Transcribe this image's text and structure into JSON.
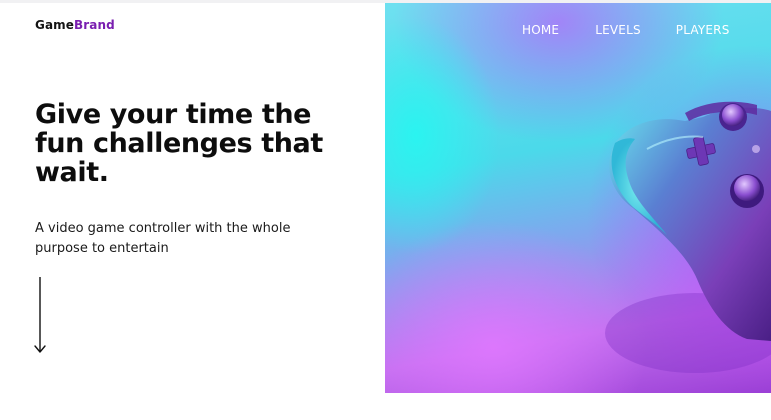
{
  "brand": {
    "part1": "Game",
    "part2": "Brand"
  },
  "nav": {
    "items": [
      {
        "label": "HOME"
      },
      {
        "label": "LEVELS"
      },
      {
        "label": "PLAYERS"
      }
    ]
  },
  "hero": {
    "headline": "Give your time the fun challenges that wait.",
    "subtitle": "A video game controller with the whole purpose to entertain",
    "image": "game-controller-photo",
    "scroll_icon": "arrow-down-icon"
  },
  "colors": {
    "brand_accent": "#7a1fb0",
    "text_dark": "#0d0d0d",
    "cyan": "#2ff5f0",
    "purple": "#9b3fd6",
    "nav_text": "#ffffff"
  }
}
